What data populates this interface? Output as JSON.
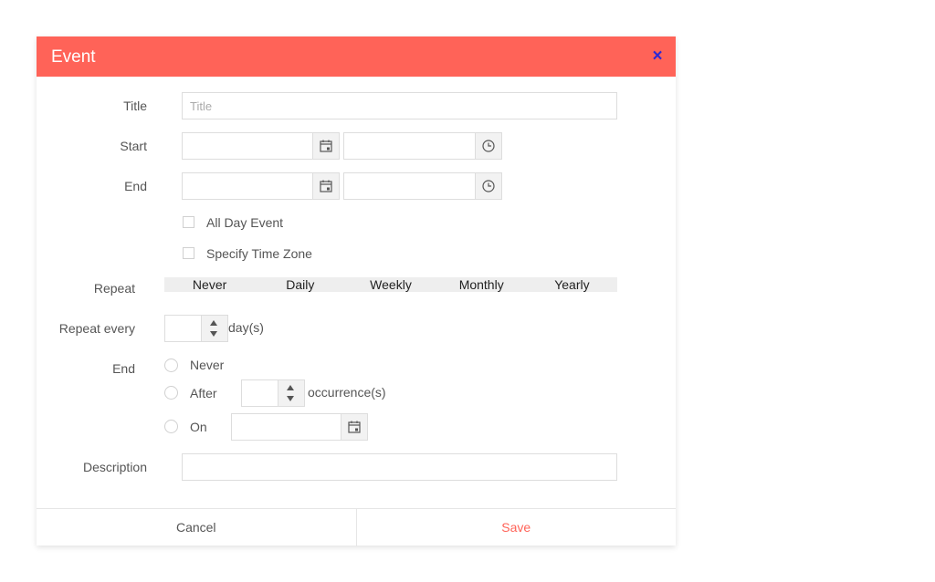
{
  "dialog": {
    "title": "Event",
    "close_glyph": "×",
    "accent_color": "#ff6358"
  },
  "form": {
    "title_label": "Title",
    "title_placeholder": "Title",
    "title_value": "",
    "start_label": "Start",
    "end_label": "End",
    "all_day_label": "All Day Event",
    "time_zone_label": "Specify Time Zone",
    "repeat_label": "Repeat",
    "repeat_options": [
      "Never",
      "Daily",
      "Weekly",
      "Monthly",
      "Yearly"
    ],
    "repeat_every_label": "Repeat every",
    "repeat_every_unit": "day(s)",
    "end_rule_label": "End",
    "end_never_label": "Never",
    "end_after_label": "After",
    "end_after_unit": "occurrence(s)",
    "end_on_label": "On",
    "description_label": "Description",
    "date_icon": "calendar-icon",
    "time_icon": "clock-icon"
  },
  "footer": {
    "cancel_label": "Cancel",
    "save_label": "Save"
  }
}
